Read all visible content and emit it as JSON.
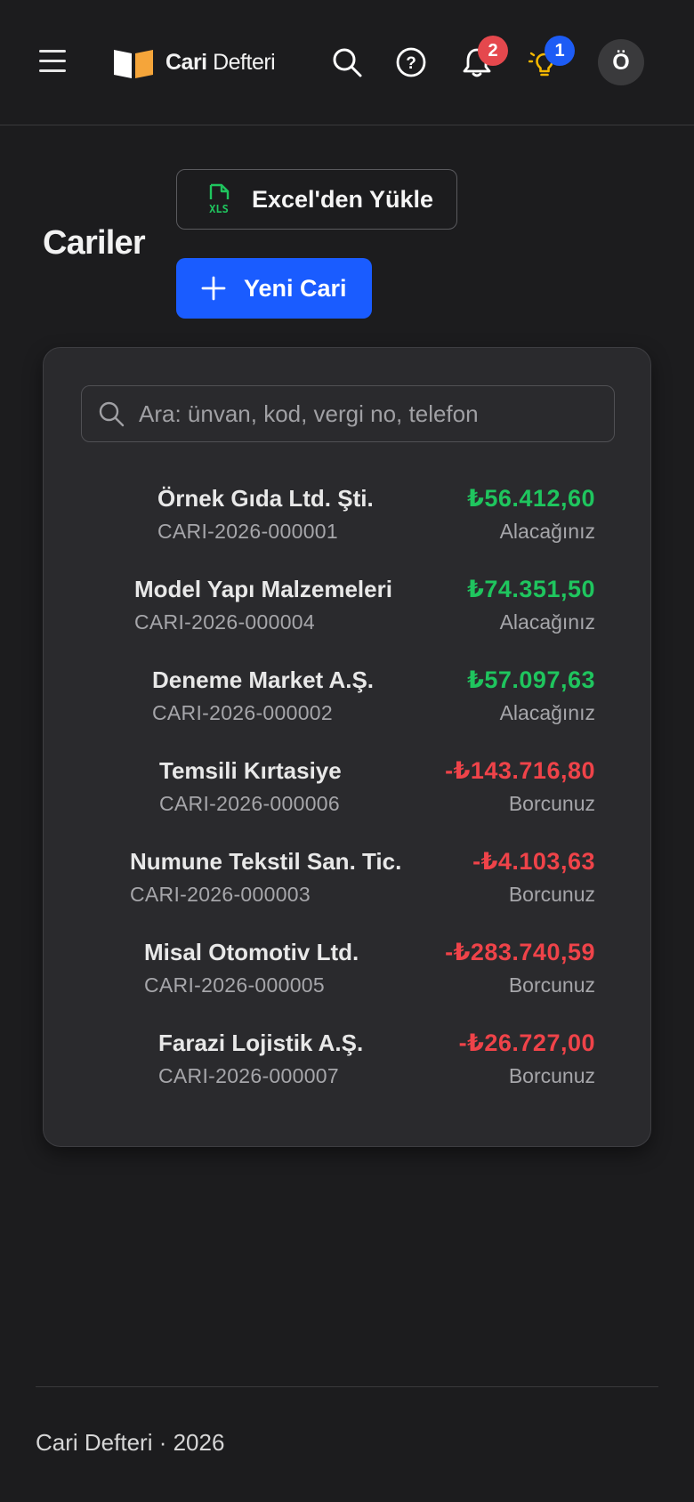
{
  "header": {
    "brand_bold": "Cari",
    "brand_light": "Defteri",
    "notifications_count": "2",
    "tips_count": "1",
    "avatar_initial": "Ö"
  },
  "page": {
    "title": "Cariler",
    "excel_button": "Excel'den Yükle",
    "new_button": "Yeni Cari"
  },
  "search": {
    "placeholder": "Ara: ünvan, kod, vergi no, telefon",
    "value": ""
  },
  "accounts": [
    {
      "name": "Örnek Gıda Ltd. Şti.",
      "code": "CARI-2026-000001",
      "amount": "₺56.412,60",
      "status": "Alacağınız"
    },
    {
      "name": "Model Yapı Malzemeleri",
      "code": "CARI-2026-000004",
      "amount": "₺74.351,50",
      "status": "Alacağınız"
    },
    {
      "name": "Deneme Market A.Ş.",
      "code": "CARI-2026-000002",
      "amount": "₺57.097,63",
      "status": "Alacağınız"
    },
    {
      "name": "Temsili Kırtasiye",
      "code": "CARI-2026-000006",
      "amount": "-₺143.716,80",
      "status": "Borcunuz"
    },
    {
      "name": "Numune Tekstil San. Tic.",
      "code": "CARI-2026-000003",
      "amount": "-₺4.103,63",
      "status": "Borcunuz"
    },
    {
      "name": "Misal Otomotiv Ltd.",
      "code": "CARI-2026-000005",
      "amount": "-₺283.740,59",
      "status": "Borcunuz"
    },
    {
      "name": "Farazi Lojistik A.Ş.",
      "code": "CARI-2026-000007",
      "amount": "-₺26.727,00",
      "status": "Borcunuz"
    }
  ],
  "footer": {
    "text": "Cari Defteri · 2026"
  },
  "colors": {
    "accent": "#1a5cff",
    "positive": "#1fc55e",
    "negative": "#ef4349",
    "badge_red": "#e5484d",
    "badge_blue": "#1d5cf5",
    "excel_green": "#1fc55e",
    "bulb_yellow": "#f5b800"
  },
  "icons": [
    "menu-icon",
    "book-logo-icon",
    "search-icon",
    "help-icon",
    "bell-icon",
    "lightbulb-icon",
    "excel-file-icon",
    "plus-icon"
  ]
}
